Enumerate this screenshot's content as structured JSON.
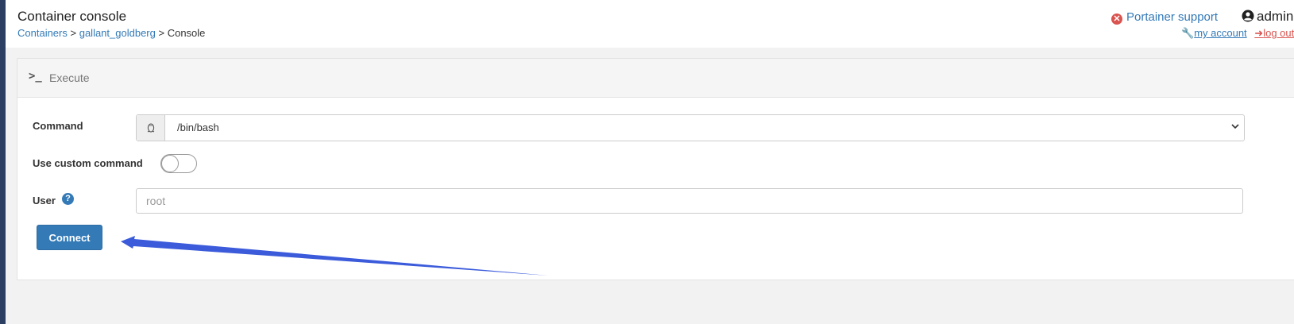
{
  "header": {
    "title": "Container console",
    "breadcrumb": {
      "containers": "Containers",
      "sep1": ">",
      "container": "gallant_goldberg",
      "sep2": ">",
      "current": "Console"
    },
    "support_label": "Portainer support",
    "username": "admin",
    "my_account": "my account",
    "log_out": "log out"
  },
  "panel": {
    "title": "Execute",
    "command_label": "Command",
    "command_value": "/bin/bash",
    "custom_command_label": "Use custom command",
    "custom_command_enabled": false,
    "user_label": "User",
    "user_placeholder": "root",
    "connect_label": "Connect"
  },
  "colors": {
    "accent": "#337ab7",
    "danger": "#d9534f",
    "annotation_arrow": "#3b5bdb"
  },
  "icons": [
    "terminal-icon",
    "linux-icon",
    "help-icon",
    "support-icon",
    "user-circle-icon",
    "wrench-icon",
    "sign-out-icon",
    "chevron-down-icon"
  ]
}
